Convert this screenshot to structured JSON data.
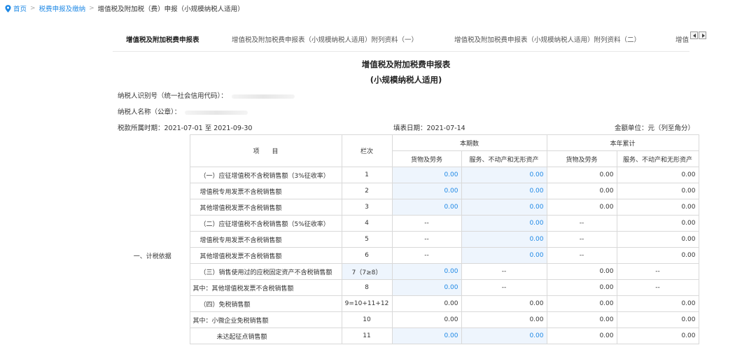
{
  "breadcrumb": {
    "items": [
      "首页",
      "税费申报及缴纳",
      "增值税及附加税（费）申报（小规模纳税人适用）"
    ],
    "pin_icon": "location-pin-icon",
    "accent": "#1e88e5"
  },
  "tabs": [
    {
      "label": "增值税及附加税费申报表",
      "active": true
    },
    {
      "label": "增值税及附加税费申报表（小规模纳税人适用）附列资料（一）",
      "active": false
    },
    {
      "label": "增值税及附加税费申报表（小规模纳税人适用）附列资料（二）",
      "active": false
    },
    {
      "label": "增值",
      "active": false
    }
  ],
  "form": {
    "title": "增值税及附加税费申报表",
    "subtitle": "(小规模纳税人适用)",
    "taxpayer_id_label": "纳税人识别号（统一社会信用代码）：",
    "taxpayer_name_label": "纳税人名称（公章）：",
    "period_label": "税款所属时期：2021-07-01 至 2021-09-30",
    "fill_date_label": "填表日期：2021-07-14",
    "unit_label": "金额单位：元（列至角分）"
  },
  "table": {
    "section_label": "一、计税依据",
    "headers": {
      "item": "项　　目",
      "line": "栏次",
      "current_period": "本期数",
      "year_total": "本年累计",
      "goods": "货物及劳务",
      "services": "服务、不动产和无形资产"
    },
    "rows": [
      {
        "item": "（一）应征增值税不含税销售额（3%征收率）",
        "line": "1",
        "cur_goods": "0.00",
        "cur_services": "0.00",
        "year_goods": "0.00",
        "year_services": "0.00"
      },
      {
        "item": "增值税专用发票不含税销售额",
        "line": "2",
        "cur_goods": "0.00",
        "cur_services": "0.00",
        "year_goods": "0.00",
        "year_services": "0.00"
      },
      {
        "item": "其他增值税发票不含税销售额",
        "line": "3",
        "cur_goods": "0.00",
        "cur_services": "0.00",
        "year_goods": "0.00",
        "year_services": "0.00"
      },
      {
        "item": "（二）应征增值税不含税销售额（5%征收率）",
        "line": "4",
        "cur_goods": "--",
        "cur_services": "0.00",
        "year_goods": "--",
        "year_services": "0.00"
      },
      {
        "item": "增值税专用发票不含税销售额",
        "line": "5",
        "cur_goods": "--",
        "cur_services": "0.00",
        "year_goods": "--",
        "year_services": "0.00"
      },
      {
        "item": "其他增值税发票不含税销售额",
        "line": "6",
        "cur_goods": "--",
        "cur_services": "0.00",
        "year_goods": "--",
        "year_services": "0.00"
      },
      {
        "item": "（三）销售使用过的应税固定资产不含税销售额",
        "line": "7（7≥8）",
        "cur_goods": "0.00",
        "cur_services": "--",
        "year_goods": "0.00",
        "year_services": "--"
      },
      {
        "item": "其中：其他增值税发票不含税销售额",
        "line": "8",
        "cur_goods": "0.00",
        "cur_services": "--",
        "year_goods": "0.00",
        "year_services": "--"
      },
      {
        "item": "（四）免税销售额",
        "line": "9=10+11+12",
        "cur_goods": "0.00",
        "cur_services": "0.00",
        "year_goods": "0.00",
        "year_services": "0.00"
      },
      {
        "item": "其中：小微企业免税销售额",
        "line": "10",
        "cur_goods": "0.00",
        "cur_services": "0.00",
        "year_goods": "0.00",
        "year_services": "0.00"
      },
      {
        "item": "未达起征点销售额",
        "line": "11",
        "cur_goods": "0.00",
        "cur_services": "0.00",
        "year_goods": "0.00",
        "year_services": "0.00"
      }
    ]
  }
}
